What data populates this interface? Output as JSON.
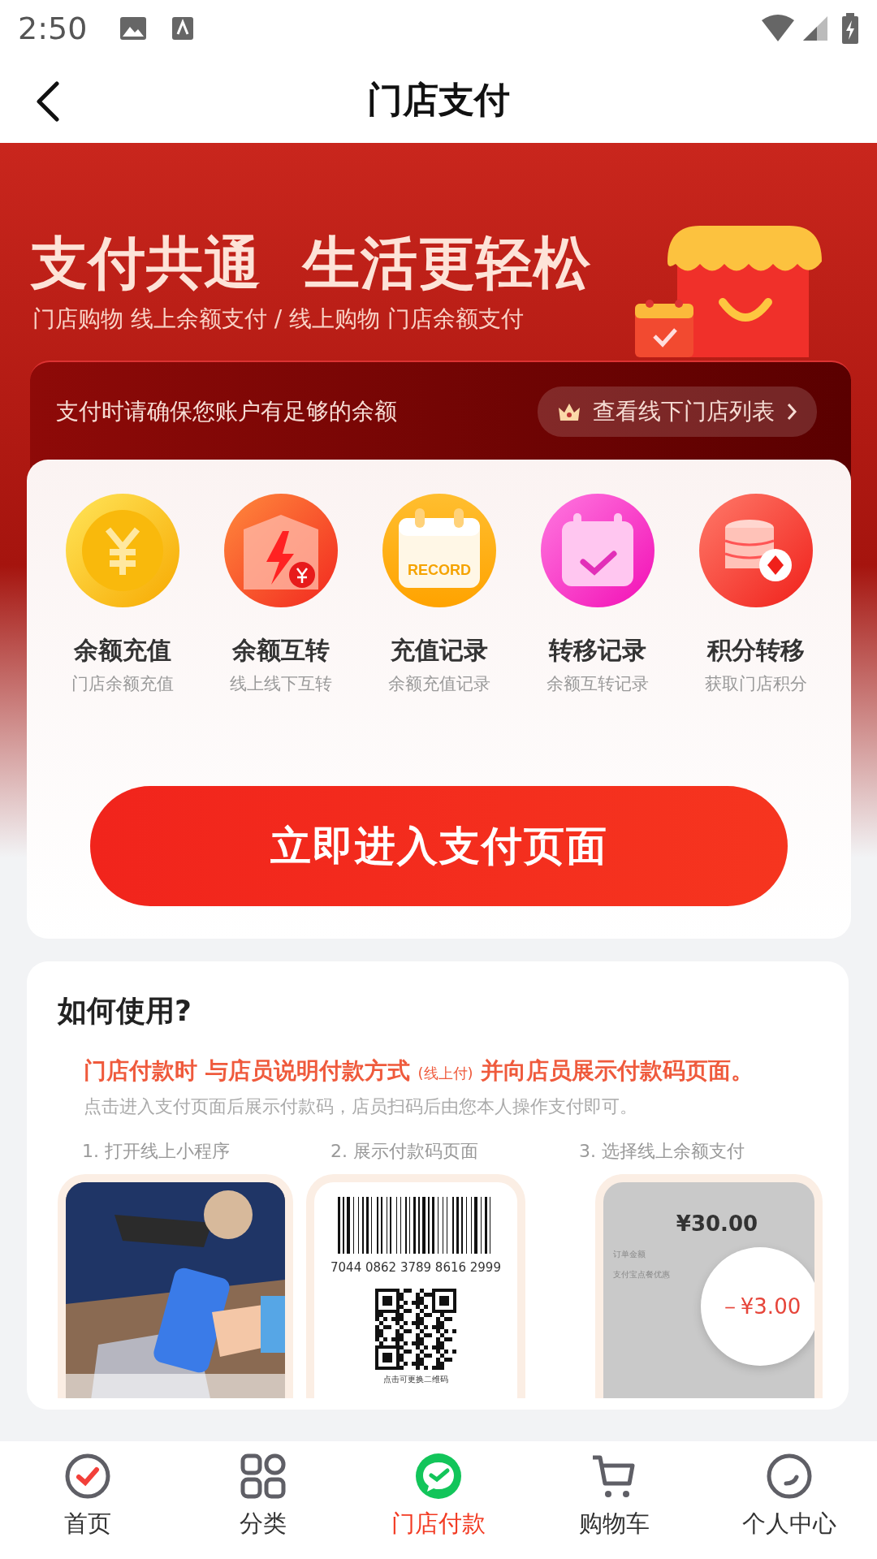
{
  "status_bar": {
    "time": "2:50"
  },
  "header": {
    "title": "门店支付"
  },
  "banner": {
    "headline": "支付共通  生活更轻松",
    "subtitle": "门店购物 线上余额支付 / 线上购物 门店余额支付"
  },
  "notice": {
    "text": "支付时请确保您账户有足够的余额",
    "store_list_button": "查看线下门店列表"
  },
  "features": [
    {
      "kind": "coin",
      "title": "余额充值",
      "subtitle": "门店余额充值"
    },
    {
      "kind": "bolt",
      "title": "余额互转",
      "subtitle": "线上线下互转"
    },
    {
      "kind": "calendar",
      "title": "充值记录",
      "subtitle": "余额充值记录",
      "icon_text": "RECORD"
    },
    {
      "kind": "check",
      "title": "转移记录",
      "subtitle": "余额互转记录"
    },
    {
      "kind": "coins",
      "title": "积分转移",
      "subtitle": "获取门店积分"
    }
  ],
  "enter_button": "立即进入支付页面",
  "how_to": {
    "title": "如何使用?",
    "instruction": {
      "before": "门店付款时 与店员说明付款方式",
      "small": "(线上付)",
      "after": "并向店员展示付款码页面。"
    },
    "note": "点击进入支付页面后展示付款码，店员扫码后由您本人操作支付即可。",
    "steps": [
      {
        "kind": "picture",
        "label": "1. 打开线上小程序"
      },
      {
        "kind": "code",
        "label": "2. 展示付款码页面",
        "code_number": "7044 0862 3789 8616 2999",
        "hint": "点击可更换二维码"
      },
      {
        "kind": "amount",
        "label": "3. 选择线上余额支付",
        "amount": "¥30.00",
        "lines": [
          "订单金额",
          "支付宝点餐优惠"
        ],
        "discount": "－¥3.00"
      }
    ]
  },
  "tab_bar": [
    {
      "kind": "home",
      "label": "首页",
      "selected": false
    },
    {
      "kind": "grid",
      "label": "分类",
      "selected": false
    },
    {
      "kind": "pay",
      "label": "门店付款",
      "selected": true
    },
    {
      "kind": "cart",
      "label": "购物车",
      "selected": false
    },
    {
      "kind": "user",
      "label": "个人中心",
      "selected": false
    }
  ]
}
